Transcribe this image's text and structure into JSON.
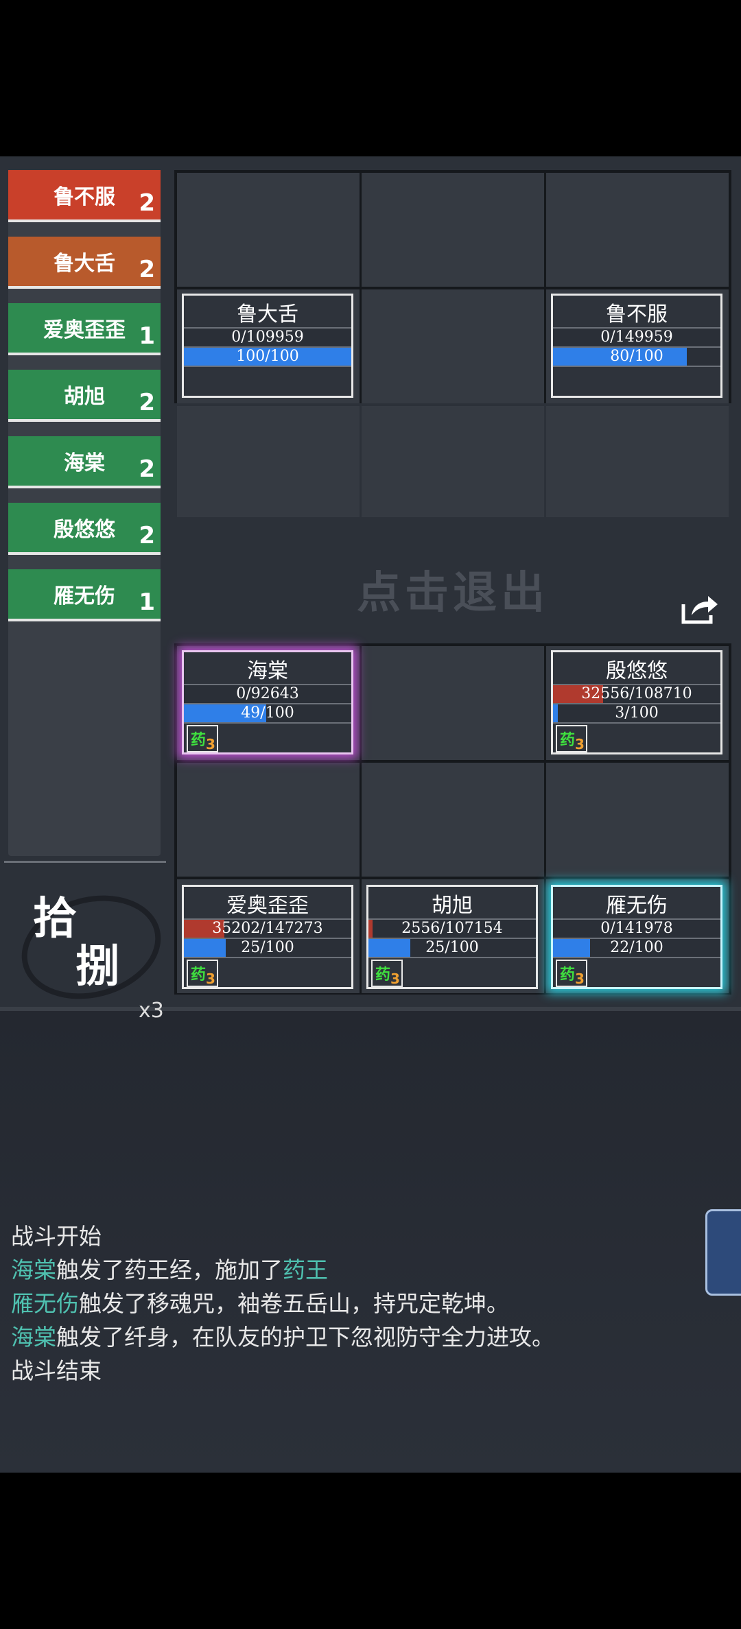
{
  "sidebar": {
    "items": [
      {
        "name": "鲁不服",
        "count": "2",
        "color": "#c9402a"
      },
      {
        "name": "鲁大舌",
        "count": "2",
        "color": "#b85a2c"
      },
      {
        "name": "爱奥歪歪",
        "count": "1",
        "color": "#2e8b50"
      },
      {
        "name": "胡旭",
        "count": "2",
        "color": "#2e8b50"
      },
      {
        "name": "海棠",
        "count": "2",
        "color": "#2e8b50"
      },
      {
        "name": "殷悠悠",
        "count": "2",
        "color": "#2e8b50"
      },
      {
        "name": "雁无伤",
        "count": "1",
        "color": "#2e8b50"
      }
    ]
  },
  "skill": {
    "char1": "拾",
    "char2": "捌",
    "multiplier": "x3"
  },
  "tap_to_exit": "点击退出",
  "enemies": [
    {
      "name": "鲁大舌",
      "hp": "0/109959",
      "hp_frac": 0,
      "mp": "100/100",
      "mp_frac": 1.0
    },
    {
      "name": "鲁不服",
      "hp": "0/149959",
      "hp_frac": 0,
      "mp": "80/100",
      "mp_frac": 0.8
    }
  ],
  "allies": [
    {
      "name": "海棠",
      "hp": "0/92643",
      "hp_frac": 0,
      "mp": "49/100",
      "mp_frac": 0.49,
      "buff": "药",
      "buff_count": "3"
    },
    {
      "name": "殷悠悠",
      "hp": "32556/108710",
      "hp_frac": 0.3,
      "mp": "3/100",
      "mp_frac": 0.03,
      "buff": "药",
      "buff_count": "3"
    },
    {
      "name": "爱奥歪歪",
      "hp": "35202/147273",
      "hp_frac": 0.24,
      "mp": "25/100",
      "mp_frac": 0.25,
      "buff": "药",
      "buff_count": "3"
    },
    {
      "name": "胡旭",
      "hp": "2556/107154",
      "hp_frac": 0.024,
      "mp": "25/100",
      "mp_frac": 0.25,
      "buff": "药",
      "buff_count": "3"
    },
    {
      "name": "雁无伤",
      "hp": "0/141978",
      "hp_frac": 0,
      "mp": "22/100",
      "mp_frac": 0.22,
      "buff": "药",
      "buff_count": "3"
    }
  ],
  "log": {
    "l1": "战斗开始",
    "l2a": "海棠",
    "l2b": "触发了药王经，施加了",
    "l2c": "药王",
    "l3a": "雁无伤",
    "l3b": "触发了移魂咒，袖卷五岳山，持咒定乾坤。",
    "l4a": "海棠",
    "l4b": "触发了纤身，在队友的护卫下忽视防守全力进攻。",
    "l5": "战斗结束"
  }
}
